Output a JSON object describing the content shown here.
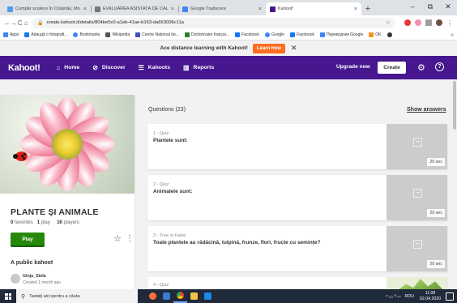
{
  "browser": {
    "tabs": [
      {
        "label": "Cumpăr scutece în Chișinău, Mo",
        "color": "#4f9be9"
      },
      {
        "label": "EVALUAREA ASISTATĂ DE CALCUL",
        "color": "#777777"
      },
      {
        "label": "Google Traducere",
        "color": "#4285f4"
      },
      {
        "label": "Kahoot!",
        "color": "#46178f"
      }
    ],
    "new_tab": "+",
    "win_minimize": "–",
    "win_maximize": "⧉",
    "win_close": "✕",
    "back": "←",
    "forward": "→",
    "reload": "C",
    "home": "⌂",
    "url": "create.kahoot.it/details/804be5c0-a1eb-41ae-b163-da663006c11a",
    "lock": "🔒",
    "bookmark_star": "☆",
    "bookmarks": [
      {
        "label": "Apps",
        "color": "#4285f4"
      },
      {
        "label": "Adaugă o fotografi...",
        "color": "#1877f2"
      },
      {
        "label": "Bookmarks",
        "color": "#4285f4"
      },
      {
        "label": "Wikipedia",
        "color": "#555555"
      },
      {
        "label": "Centre National de...",
        "color": "#3f51b5"
      },
      {
        "label": "Dictionnaire françai...",
        "color": "#2e7d32"
      },
      {
        "label": "Facebook",
        "color": "#1877f2"
      },
      {
        "label": "Google",
        "color": "#4285f4"
      },
      {
        "label": "Facebook",
        "color": "#1877f2"
      },
      {
        "label": "Переводчик Google",
        "color": "#4285f4"
      },
      {
        "label": "OK",
        "color": "#f7931e"
      }
    ],
    "bookmarks_more": "»"
  },
  "banner": {
    "text": "Ace distance learning with Kahoot!",
    "button": "Learn how",
    "close": "✕"
  },
  "nav": {
    "logo": "Kahoot!",
    "items": [
      {
        "label": "Home",
        "icon": "⌂"
      },
      {
        "label": "Discover",
        "icon": "⊘"
      },
      {
        "label": "Kahoots",
        "icon": "☰"
      },
      {
        "label": "Reports",
        "icon": "▥"
      }
    ],
    "upgrade": "Upgrade now",
    "create": "Create",
    "settings_icon": "⚙",
    "help_icon": "?"
  },
  "kahoot": {
    "title": "PLANTE ȘI ANIMALE",
    "favorites_count": "0",
    "favorites_label": "favorites",
    "plays_count": "1",
    "plays_label": "play",
    "players_count": "16",
    "players_label": "players",
    "play_button": "Play",
    "star_icon": "☆",
    "more_icon": "⋮",
    "visibility": "A public kahoot",
    "author": "Ginju_Stela",
    "created": "Created 1 month ago"
  },
  "questions": {
    "header": "Questions (23)",
    "show_answers": "Show answers",
    "items": [
      {
        "type": "1 - Quiz",
        "text": "Plantele sunt:",
        "time": "20 sec"
      },
      {
        "type": "2 - Quiz",
        "text": "Animalele sunt:",
        "time": "20 sec"
      },
      {
        "type": "3 - True or False",
        "text": "Toate plantele au rădăcină, tulpină, frunze, flori, fructe cu semințe?",
        "time": "20 sec"
      },
      {
        "type": "4 - Quiz",
        "text": "",
        "time": ""
      }
    ]
  },
  "taskbar": {
    "search_placeholder": "Tastați aici pentru a căuta",
    "tray_icons": "^ ▭ ⁽⁽ ꟷ",
    "language": "ROU",
    "time": "11:08",
    "date": "02.04.2020"
  },
  "colors": {
    "kahoot_purple": "#46178f",
    "play_green": "#26890c",
    "learn_orange": "#ff6d1f"
  }
}
